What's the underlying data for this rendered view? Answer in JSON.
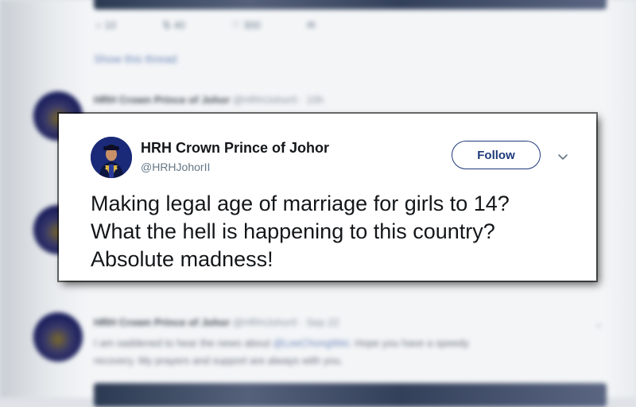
{
  "background": {
    "top_actions": [
      "10",
      "40",
      "300"
    ],
    "show_thread_label": "Show this thread",
    "tweets": [
      {
        "name": "HRH Crown Prince of Johor",
        "handle": "@HRHJohorII",
        "time": "· 10h"
      },
      {
        "name": "HRH Crown Prince of Johor",
        "handle": "@HRHJohorII",
        "time": "· Sep 22"
      }
    ],
    "tweet3_lines": [
      "I am saddened to hear the news about ",
      "@LeeChongWei",
      ". Hope you have a speedy",
      "recovery. My prayers and support are always with you."
    ]
  },
  "tweet": {
    "display_name": "HRH Crown Prince of Johor",
    "handle": "@HRHJohorII",
    "follow_label": "Follow",
    "text_lines": [
      "Making legal age of marriage for girls to 14?",
      "What the hell is happening to this country?",
      "Absolute madness!"
    ]
  },
  "icons": {
    "avatar": "uniformed-profile-avatar",
    "caret": "chevron-down-icon",
    "bg_reply": "reply-icon",
    "bg_retweet": "retweet-icon",
    "bg_like": "heart-icon",
    "bg_dm": "envelope-icon"
  },
  "colors": {
    "follow_border": "#1d3a7a",
    "avatar_bg": "#1a2a78",
    "text": "#14171a",
    "handle": "#657786"
  }
}
